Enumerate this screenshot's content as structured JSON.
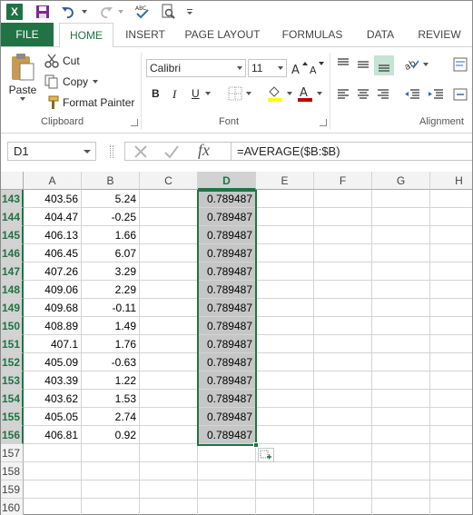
{
  "quick_access": {
    "app_icon": "X",
    "icons": [
      "excel-logo-icon",
      "save-icon",
      "undo-icon",
      "redo-icon",
      "spelling-icon",
      "print-preview-icon"
    ]
  },
  "tabs": {
    "file": "FILE",
    "home": "HOME",
    "insert": "INSERT",
    "page_layout": "PAGE LAYOUT",
    "formulas": "FORMULAS",
    "data": "DATA",
    "review": "REVIEW"
  },
  "ribbon": {
    "clipboard": {
      "paste": "Paste",
      "cut": "Cut",
      "copy": "Copy",
      "format_painter": "Format Painter",
      "label": "Clipboard"
    },
    "font": {
      "font_name": "Calibri",
      "font_size": "11",
      "bold": "B",
      "italic": "I",
      "underline": "U",
      "label": "Font"
    },
    "alignment": {
      "label": "Alignment"
    }
  },
  "formula_bar": {
    "name_box": "D1",
    "fx": "fx",
    "formula": "=AVERAGE($B:$B)"
  },
  "colors": {
    "excel_green": "#217346",
    "selection_fill": "#c6c6c6",
    "font_color_accent": "#c00000",
    "highlight_accent": "#ffff00"
  },
  "sheet": {
    "columns": [
      "A",
      "B",
      "C",
      "D",
      "E",
      "F",
      "G",
      "H"
    ],
    "selected_column": "D",
    "rows": [
      {
        "num": "143",
        "a": "403.56",
        "b": "5.24",
        "d": "0.789487"
      },
      {
        "num": "144",
        "a": "404.47",
        "b": "-0.25",
        "d": "0.789487"
      },
      {
        "num": "145",
        "a": "406.13",
        "b": "1.66",
        "d": "0.789487"
      },
      {
        "num": "146",
        "a": "406.45",
        "b": "6.07",
        "d": "0.789487"
      },
      {
        "num": "147",
        "a": "407.26",
        "b": "3.29",
        "d": "0.789487"
      },
      {
        "num": "148",
        "a": "409.06",
        "b": "2.29",
        "d": "0.789487"
      },
      {
        "num": "149",
        "a": "409.68",
        "b": "-0.11",
        "d": "0.789487"
      },
      {
        "num": "150",
        "a": "408.89",
        "b": "1.49",
        "d": "0.789487"
      },
      {
        "num": "151",
        "a": "407.1",
        "b": "1.76",
        "d": "0.789487"
      },
      {
        "num": "152",
        "a": "405.09",
        "b": "-0.63",
        "d": "0.789487"
      },
      {
        "num": "153",
        "a": "403.39",
        "b": "1.22",
        "d": "0.789487"
      },
      {
        "num": "154",
        "a": "403.62",
        "b": "1.53",
        "d": "0.789487"
      },
      {
        "num": "155",
        "a": "405.05",
        "b": "2.74",
        "d": "0.789487"
      },
      {
        "num": "156",
        "a": "406.81",
        "b": "0.92",
        "d": "0.789487"
      },
      {
        "num": "157",
        "a": "",
        "b": "",
        "d": ""
      },
      {
        "num": "158",
        "a": "",
        "b": "",
        "d": ""
      },
      {
        "num": "159",
        "a": "",
        "b": "",
        "d": ""
      },
      {
        "num": "160",
        "a": "",
        "b": "",
        "d": ""
      }
    ]
  }
}
